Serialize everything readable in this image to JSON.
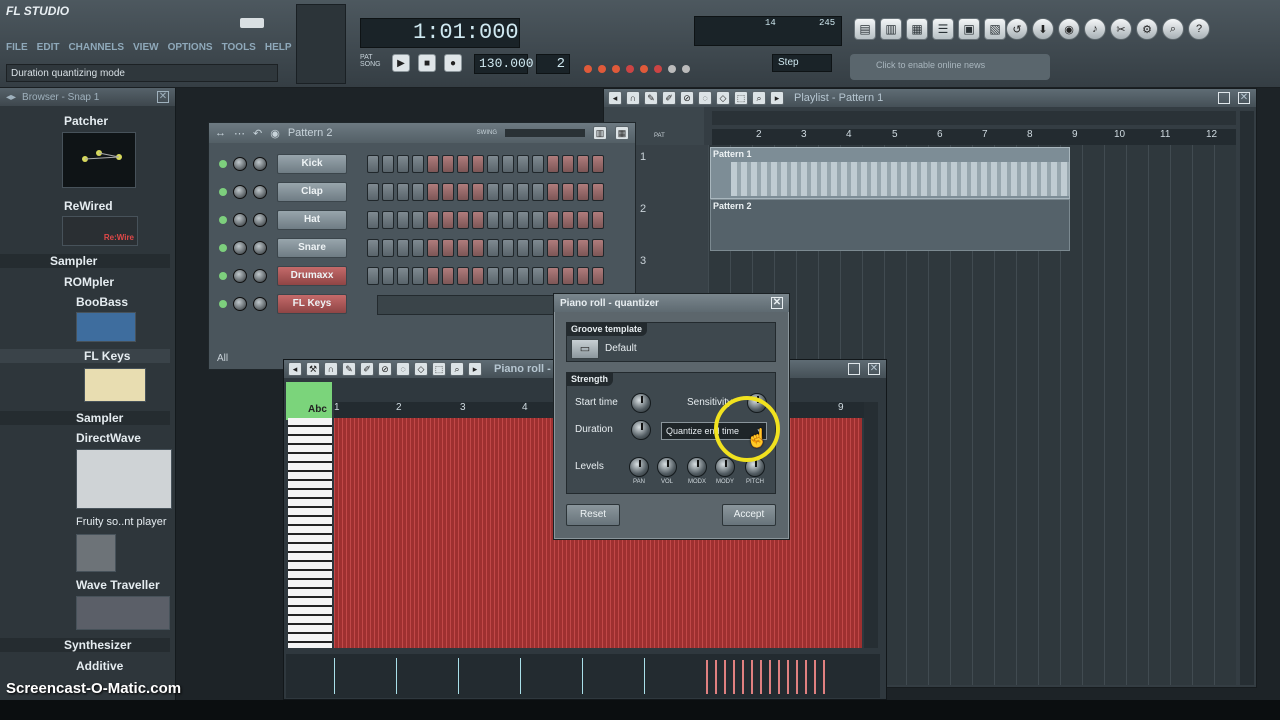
{
  "app": {
    "logo": "FL STUDIO"
  },
  "menu": [
    "FILE",
    "EDIT",
    "CHANNELS",
    "VIEW",
    "OPTIONS",
    "TOOLS",
    "HELP"
  ],
  "hint_text": "Duration quantizing mode",
  "transport": {
    "time": "1:01:000",
    "tempo": "130.000",
    "pattern": "2",
    "snap": "Step",
    "cpu": "14",
    "poly": "245",
    "news": "Click to enable online news"
  },
  "browser": {
    "title": "Browser - Snap 1",
    "items": [
      {
        "label": "Patcher",
        "type": "plugin"
      },
      {
        "label": "ReWired",
        "type": "plugin"
      },
      {
        "label": "Sampler",
        "type": "folder"
      },
      {
        "label": "ROMpler",
        "type": "folder"
      },
      {
        "label": "BooBass",
        "type": "plugin"
      },
      {
        "label": "FL Keys",
        "type": "plugin"
      },
      {
        "label": "Sampler",
        "type": "folder"
      },
      {
        "label": "DirectWave",
        "type": "plugin"
      },
      {
        "label": "Fruity so..nt player",
        "type": "plugin"
      },
      {
        "label": "Wave Traveller",
        "type": "plugin"
      },
      {
        "label": "Synthesizer",
        "type": "folder"
      },
      {
        "label": "Additive",
        "type": "folder"
      }
    ],
    "rewire_thumb_text": "Re:Wire"
  },
  "channel_rack": {
    "title": "Pattern 2",
    "swing_label": "SWING",
    "filter": "All",
    "channels": [
      {
        "name": "Kick",
        "color": "grey"
      },
      {
        "name": "Clap",
        "color": "grey"
      },
      {
        "name": "Hat",
        "color": "grey"
      },
      {
        "name": "Snare",
        "color": "grey"
      },
      {
        "name": "Drumaxx",
        "color": "red"
      },
      {
        "name": "FL Keys",
        "color": "red"
      }
    ]
  },
  "playlist": {
    "title": "Playlist - Pattern 1",
    "ruler": [
      "2",
      "3",
      "4",
      "5",
      "6",
      "7",
      "8",
      "9",
      "10",
      "11",
      "12"
    ],
    "tracks": [
      "1",
      "2",
      "3"
    ],
    "clips": [
      "Pattern 1",
      "Pattern 2"
    ],
    "pat_label": "PAT"
  },
  "piano_roll": {
    "title": "Piano roll -",
    "ruler": [
      "1",
      "2",
      "3",
      "4",
      "9"
    ],
    "abc": "Abc"
  },
  "quantizer": {
    "title": "Piano roll - quantizer",
    "groove_label": "Groove template",
    "groove_value": "Default",
    "strength_label": "Strength",
    "start_time": "Start time",
    "sensitivity": "Sensitivity",
    "duration": "Duration",
    "duration_mode": "Quantize end time",
    "levels": "Levels",
    "level_knobs": [
      "PAN",
      "VOL",
      "MODX",
      "MODY",
      "PITCH"
    ],
    "reset": "Reset",
    "accept": "Accept"
  },
  "watermark": "Screencast-O-Matic.com",
  "colors": {
    "accent": "#e03b3b",
    "highlight_ring": "#f1e21f",
    "groove_dark": "#232a2e"
  }
}
